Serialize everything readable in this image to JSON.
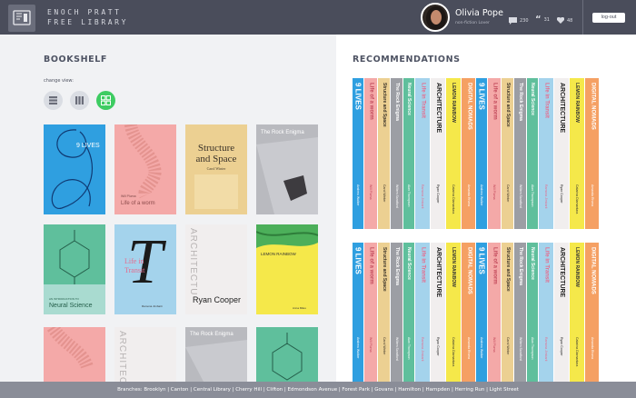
{
  "header": {
    "brand_line1": "ENOCH PRATT",
    "brand_line2": "FREE LIBRARY",
    "user_name": "Olivia Pope",
    "user_role": "non-fiction Lover",
    "stats": {
      "comments": "230",
      "quotes": "31",
      "likes": "48"
    },
    "logout_label": "log-out"
  },
  "bookshelf": {
    "title": "BOOKSHELF",
    "change_view_label": "change view:",
    "books": [
      {
        "line1": "9 LIVES",
        "line2": ""
      },
      {
        "line1": "Will Pluma",
        "line2": "Life of a worm"
      },
      {
        "line1": "Structure and Space",
        "line2": "Carol Winter"
      },
      {
        "line1": "The Rock Enigma",
        "line2": ""
      },
      {
        "line1": "AN INTRODUCTION TO",
        "line2": "Neural Science"
      },
      {
        "line1": "Life in Transit",
        "line2": "Ramona Jimbarti"
      },
      {
        "line1": "ARCHITECTURE",
        "line2": "Ryan Cooper"
      },
      {
        "line1": "LEMON RAINBOW",
        "line2": "Anna Miles"
      },
      {
        "line1": "",
        "line2": ""
      },
      {
        "line1": "ARCHITECTURE",
        "line2": ""
      },
      {
        "line1": "The Rock Enigma",
        "line2": ""
      },
      {
        "line1": "",
        "line2": ""
      }
    ]
  },
  "recommendations": {
    "title": "RECOMMENDATIONS",
    "spines": [
      {
        "title": "9 LIVES",
        "author": "Andrew Walker"
      },
      {
        "title": "Life of a worm",
        "author": "Will Pluma"
      },
      {
        "title": "Structure and Space",
        "author": "Carol Winter"
      },
      {
        "title": "The Rock Enigma",
        "author": "Willem Sandford"
      },
      {
        "title": "Neural Science",
        "author": "Alan Thompson"
      },
      {
        "title": "Life in Transit",
        "author": "Ramona Jimbarti"
      },
      {
        "title": "ARCHITECTURE",
        "author": "Ryan Cooper"
      },
      {
        "title": "LEMON RAINBOW",
        "author": "Catarina Diamantara"
      },
      {
        "title": "DIGITAL NOMADS",
        "author": "Amanda Rivera"
      }
    ]
  },
  "footer": {
    "text": "Branches:   Brooklyn  |  Canton  |  Central Library  |  Cherry Hill  |  Clifton  |  Edmondson Avenue  |  Forest Park  |  Govans  |  Hamilton  |  Hampden  |  Herring Run  |  Light Street"
  },
  "colors": {
    "header": "#4a4d5b",
    "accent_green": "#3ecc62",
    "blue": "#2f9fe0",
    "pink": "#f4a9a8",
    "sand": "#ecd092",
    "grey": "#b9babf",
    "teal": "#5fbf9c",
    "yellow": "#f5e84a",
    "orange": "#f5a063"
  }
}
